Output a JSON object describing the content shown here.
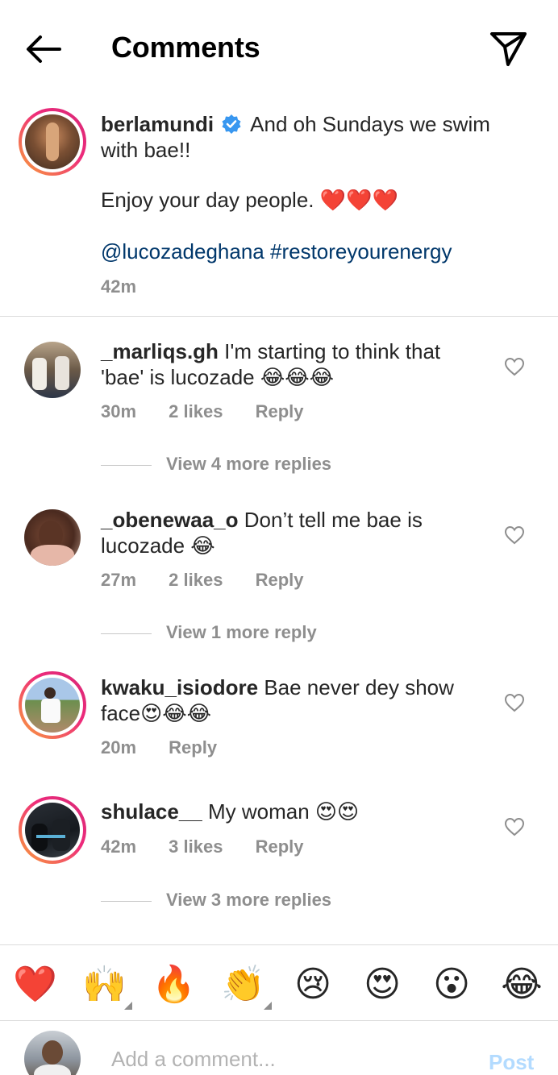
{
  "header": {
    "title": "Comments",
    "back_icon": "arrow-left-icon",
    "send_icon": "paper-plane-icon"
  },
  "caption": {
    "username": "berlamundi",
    "verified": true,
    "line1": "And oh Sundays we swim",
    "line2": "with bae!!",
    "line3": "Enjoy your day people. ❤️❤️❤️",
    "tags": "@lucozadeghana #restoreyourenergy",
    "time": "42m"
  },
  "comments": [
    {
      "username": "_marliqs.gh",
      "text_line1": "I'm starting to think that",
      "text_line2": "'bae' is lucozade 😂😂😂",
      "time": "30m",
      "likes": "2 likes",
      "reply": "Reply",
      "view_replies": "View 4 more replies"
    },
    {
      "username": "_obenewaa_o",
      "text_line1": "Don’t tell me bae is",
      "text_line2": "lucozade 😂",
      "time": "27m",
      "likes": "2 likes",
      "reply": "Reply",
      "view_replies": "View 1 more reply"
    },
    {
      "username": "kwaku_isiodore",
      "text_line1": "Bae never dey show",
      "text_line2": "face😍😂😂",
      "time": "20m",
      "reply": "Reply"
    },
    {
      "username": "shulace__",
      "text_line1": "My woman 😍😍",
      "time": "42m",
      "likes": "3 likes",
      "reply": "Reply",
      "view_replies": "View 3 more replies"
    }
  ],
  "emoji_bar": [
    "❤️",
    "🙌",
    "🔥",
    "👏",
    "😢",
    "😍",
    "😮",
    "😂"
  ],
  "comment_box": {
    "placeholder": "Add a comment...",
    "post_label": "Post"
  },
  "colors": {
    "link": "#00376b",
    "muted": "#8e8e8e",
    "verified": "#3897f0",
    "post_disabled": "#b3dbff"
  }
}
